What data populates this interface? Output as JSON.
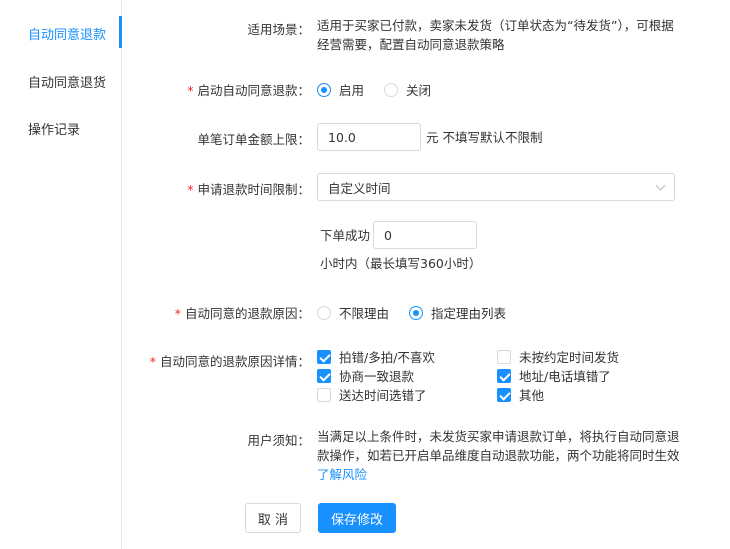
{
  "sidebar": {
    "items": [
      {
        "label": "自动同意退款"
      },
      {
        "label": "自动同意退货"
      },
      {
        "label": "操作记录"
      }
    ]
  },
  "form": {
    "scene": {
      "label": "适用场景：",
      "line1": "适用于买家已付款，卖家未发货（订单状态为“待发货”），可根据",
      "line2": "经营需要，配置自动同意退款策略"
    },
    "enable": {
      "label": "启动自动同意退款：",
      "options": [
        "启用",
        "关闭"
      ],
      "selected": "启用"
    },
    "limit": {
      "label": "单笔订单金额上限：",
      "value": "10.0",
      "hint": "元 不填写默认不限制"
    },
    "time_limit": {
      "label": "申请退款时间限制：",
      "selected": "自定义时间",
      "prefix": "下单成功",
      "hours_value": "0",
      "suffix": "小时内（最长填写360小时）"
    },
    "reason": {
      "label": "自动同意的退款原因：",
      "options": [
        "不限理由",
        "指定理由列表"
      ],
      "selected": "指定理由列表"
    },
    "reason_detail": {
      "label": "自动同意的退款原因详情：",
      "items": [
        {
          "label": "拍错/多拍/不喜欢",
          "checked": true
        },
        {
          "label": "未按约定时间发货",
          "checked": false
        },
        {
          "label": "协商一致退款",
          "checked": true
        },
        {
          "label": "地址/电话填错了",
          "checked": true
        },
        {
          "label": "送达时间选错了",
          "checked": false
        },
        {
          "label": "其他",
          "checked": true
        }
      ]
    },
    "notice": {
      "label": "用户须知：",
      "line1": "当满足以上条件时，未发货买家申请退款订单，将执行自动同意退",
      "line2": "款操作，如若已开启单品维度自动退款功能，两个功能将同时生效",
      "link": "了解风险"
    }
  },
  "actions": {
    "cancel": "取 消",
    "save": "保存修改"
  },
  "colors": {
    "accent": "#1890ff",
    "required": "#f5222d"
  }
}
